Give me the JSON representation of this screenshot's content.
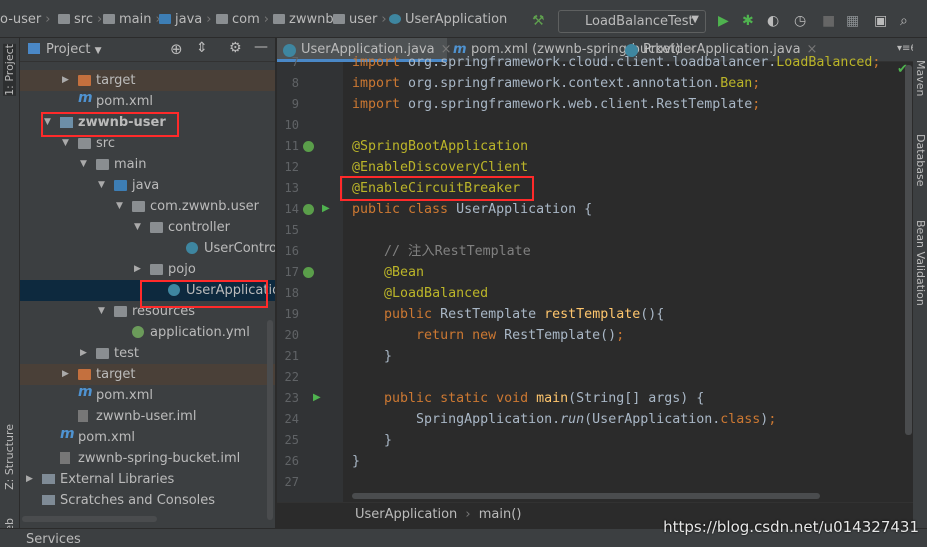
{
  "breadcrumb": [
    "o-user",
    "src",
    "main",
    "java",
    "com",
    "zwwnb",
    "user",
    "UserApplication"
  ],
  "run_config": "LoadBalanceTest",
  "left_strip": {
    "project": "1: Project",
    "structure": "Z: Structure",
    "web": "Web"
  },
  "right_strip": [
    "Maven",
    "Database",
    "Bean Validation"
  ],
  "sidebar": {
    "title": "Project",
    "items": [
      {
        "label": "target",
        "level": 2,
        "icon": "folder-orange",
        "arrow": "right",
        "state": "excluded"
      },
      {
        "label": "pom.xml",
        "level": 2,
        "icon": "maven-m"
      },
      {
        "label": "zwwnb-user",
        "level": 1,
        "icon": "module-folder",
        "arrow": "down",
        "bold": true
      },
      {
        "label": "src",
        "level": 2,
        "icon": "folder",
        "arrow": "down"
      },
      {
        "label": "main",
        "level": 3,
        "icon": "folder",
        "arrow": "down"
      },
      {
        "label": "java",
        "level": 4,
        "icon": "folder-blue",
        "arrow": "down"
      },
      {
        "label": "com.zwwnb.user",
        "level": 5,
        "icon": "package",
        "arrow": "down"
      },
      {
        "label": "controller",
        "level": 6,
        "icon": "package",
        "arrow": "down"
      },
      {
        "label": "UserController",
        "level": 8,
        "icon": "class"
      },
      {
        "label": "pojo",
        "level": 6,
        "icon": "package",
        "arrow": "right"
      },
      {
        "label": "UserApplication",
        "level": 7,
        "icon": "spring-class",
        "state": "selected"
      },
      {
        "label": "resources",
        "level": 4,
        "icon": "resources-folder",
        "arrow": "down"
      },
      {
        "label": "application.yml",
        "level": 5,
        "icon": "yml"
      },
      {
        "label": "test",
        "level": 3,
        "icon": "folder",
        "arrow": "right"
      },
      {
        "label": "target",
        "level": 2,
        "icon": "folder-orange",
        "arrow": "right",
        "state": "excluded"
      },
      {
        "label": "pom.xml",
        "level": 2,
        "icon": "maven-m"
      },
      {
        "label": "zwwnb-user.iml",
        "level": 2,
        "icon": "iml"
      },
      {
        "label": "pom.xml",
        "level": 1,
        "icon": "maven-m"
      },
      {
        "label": "zwwnb-spring-bucket.iml",
        "level": 1,
        "icon": "iml"
      },
      {
        "label": "External Libraries",
        "level": 0,
        "icon": "library",
        "arrow": "right"
      },
      {
        "label": "Scratches and Consoles",
        "level": 0,
        "icon": "scratches",
        "arrow": "none"
      }
    ]
  },
  "tabs": [
    {
      "label": "UserApplication.java",
      "icon": "spring-class",
      "active": true
    },
    {
      "label": "pom.xml (zwwnb-spring-bucket)",
      "icon": "maven-m"
    },
    {
      "label": "ProviderApplication.java",
      "icon": "spring-class"
    }
  ],
  "tab_overflow": "6",
  "code": [
    {
      "n": "7",
      "t": [
        [
          "import ",
          "kw"
        ],
        [
          "org.springframework.cloud.client.loadbalancer.",
          ""
        ],
        [
          "LoadBalanced",
          "ann"
        ],
        [
          ";",
          "kw"
        ]
      ]
    },
    {
      "n": "8",
      "t": [
        [
          "import ",
          "kw"
        ],
        [
          "org.springframework.context.annotation.",
          ""
        ],
        [
          "Bean",
          "ann"
        ],
        [
          ";",
          "kw"
        ]
      ]
    },
    {
      "n": "9",
      "t": [
        [
          "import ",
          "kw"
        ],
        [
          "org.springframework.web.client.RestTemplate",
          ""
        ],
        [
          ";",
          "kw"
        ]
      ]
    },
    {
      "n": "10",
      "t": []
    },
    {
      "n": "11",
      "t": [
        [
          "@SpringBootApplication",
          "ann"
        ]
      ],
      "gutter": "spring"
    },
    {
      "n": "12",
      "t": [
        [
          "@EnableDiscoveryClient",
          "ann"
        ]
      ]
    },
    {
      "n": "13",
      "t": [
        [
          "@EnableCircuitBreaker",
          "ann"
        ]
      ]
    },
    {
      "n": "14",
      "t": [
        [
          "public class ",
          "kw"
        ],
        [
          "UserApplication {",
          ""
        ]
      ],
      "gutter": "spring-run"
    },
    {
      "n": "15",
      "t": []
    },
    {
      "n": "16",
      "t": [
        [
          "    // 注入RestTemplate",
          "cm"
        ]
      ]
    },
    {
      "n": "17",
      "t": [
        [
          "    ",
          ""
        ],
        [
          "@Bean",
          "ann"
        ]
      ],
      "gutter": "spring"
    },
    {
      "n": "18",
      "t": [
        [
          "    ",
          ""
        ],
        [
          "@LoadBalanced",
          "ann"
        ]
      ]
    },
    {
      "n": "19",
      "t": [
        [
          "    ",
          ""
        ],
        [
          "public ",
          "kw"
        ],
        [
          "RestTemplate ",
          ""
        ],
        [
          "restTemplate",
          "fn"
        ],
        [
          "(){",
          ""
        ]
      ]
    },
    {
      "n": "20",
      "t": [
        [
          "        ",
          ""
        ],
        [
          "return new ",
          "kw"
        ],
        [
          "RestTemplate()",
          ""
        ],
        [
          ";",
          "kw"
        ]
      ]
    },
    {
      "n": "21",
      "t": [
        [
          "    }",
          ""
        ]
      ]
    },
    {
      "n": "22",
      "t": []
    },
    {
      "n": "23",
      "t": [
        [
          "    ",
          ""
        ],
        [
          "public static void ",
          "kw"
        ],
        [
          "main",
          "fn"
        ],
        [
          "(String[] args) {",
          ""
        ]
      ],
      "gutter": "run"
    },
    {
      "n": "24",
      "t": [
        [
          "        SpringApplication.",
          ""
        ],
        [
          "run",
          "it"
        ],
        [
          "(UserApplication.",
          ""
        ],
        [
          "class",
          "kw"
        ],
        [
          ")",
          ""
        ],
        [
          ";",
          "kw"
        ]
      ]
    },
    {
      "n": "25",
      "t": [
        [
          "    }",
          ""
        ]
      ]
    },
    {
      "n": "26",
      "t": [
        [
          "}",
          ""
        ]
      ]
    },
    {
      "n": "27",
      "t": []
    }
  ],
  "code_breadcrumb": [
    "UserApplication",
    "main()"
  ],
  "bottom": {
    "services": "Services"
  },
  "watermark": "https://blog.csdn.net/u014327431",
  "colors": {
    "keyword": "#cc7832",
    "annotation": "#bbb529",
    "highlight_box": "#ff2a2a",
    "selection": "#0d293e"
  }
}
